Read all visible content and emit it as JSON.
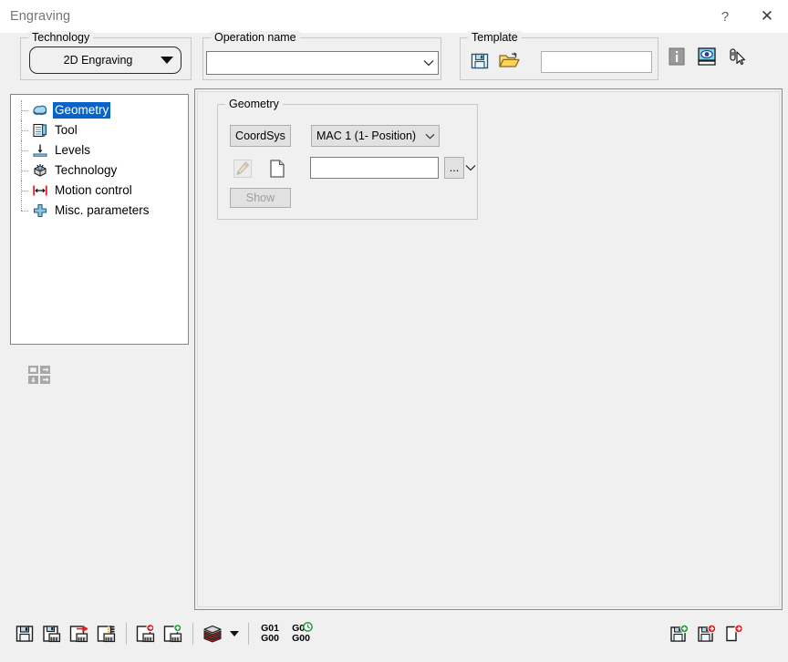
{
  "window": {
    "title": "Engraving",
    "help_label": "?",
    "close_label": "✕"
  },
  "header": {
    "technology": {
      "group_label": "Technology",
      "selected": "2D Engraving"
    },
    "operation_name": {
      "group_label": "Operation name",
      "value": "",
      "placeholder": ""
    },
    "template": {
      "group_label": "Template",
      "save_title": "Save template",
      "open_title": "Open template",
      "field_value": ""
    },
    "tools": [
      {
        "name": "info-icon",
        "title": "Info"
      },
      {
        "name": "preview-icon",
        "title": "Simulate"
      },
      {
        "name": "pick-tool-icon",
        "title": "Pick"
      }
    ]
  },
  "tree": {
    "items": [
      {
        "label": "Geometry",
        "icon": "geometry-icon",
        "selected": true
      },
      {
        "label": "Tool",
        "icon": "tool-icon",
        "selected": false
      },
      {
        "label": "Levels",
        "icon": "levels-icon",
        "selected": false
      },
      {
        "label": "Technology",
        "icon": "technology-icon",
        "selected": false
      },
      {
        "label": "Motion control",
        "icon": "motion-control-icon",
        "selected": false
      },
      {
        "label": "Misc. parameters",
        "icon": "misc-parameters-icon",
        "selected": false
      }
    ],
    "reorder_title": "Rearrange pages"
  },
  "geometry_panel": {
    "group_label": "Geometry",
    "coordsys_label": "CoordSys",
    "mac_value": "MAC 1 (1- Position)",
    "edit_title": "Edit geometry",
    "new_title": "New geometry",
    "geometry_value": "",
    "geometry_placeholder": "",
    "ellipsis_label": "...",
    "show_label": "Show"
  },
  "bottom_toolbar": {
    "left": [
      {
        "name": "save-icon",
        "title": "Save"
      },
      {
        "name": "save-calc-icon",
        "title": "Save & Calculate"
      },
      {
        "name": "save-exit-icon",
        "title": "Save & Exit"
      },
      {
        "name": "save-list-icon",
        "title": "Save & List"
      },
      {
        "name": "save-red-icon",
        "title": "Save as new"
      },
      {
        "name": "save-green-icon",
        "title": "Save & Add"
      },
      {
        "name": "layers-icon",
        "title": "Layers"
      },
      {
        "name": "g01-g00-button",
        "line1": "G01",
        "line2": "G00"
      },
      {
        "name": "g00-g00-button",
        "line1": "G00",
        "line2": "G00"
      }
    ],
    "right": [
      {
        "name": "save-add-green-icon",
        "title": "Save & Add operation"
      },
      {
        "name": "save-next-red-icon",
        "title": "Save & Next"
      },
      {
        "name": "page-next-red-icon",
        "title": "Next page"
      }
    ]
  },
  "colors": {
    "accent": "#0a64c8",
    "window_bg": "#f0f0f0",
    "field_bg": "#ffffff",
    "border": "#adadad",
    "title_text": "#757575"
  }
}
